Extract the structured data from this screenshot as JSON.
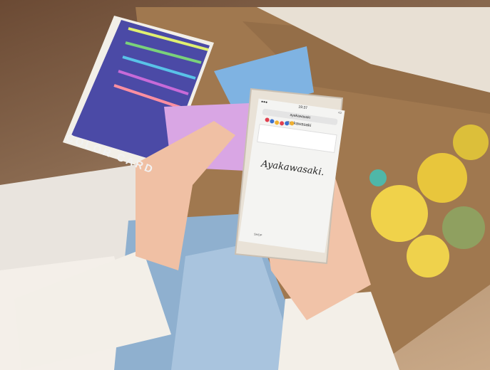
{
  "photo": {
    "card_label": "COLOR CARD",
    "phone_screen": {
      "status_time": "19:37",
      "url": "ayakawasaki",
      "site_header": "ayakawasaki",
      "logo": "Ayakawasaki.",
      "nav_label": "SHOP"
    }
  }
}
